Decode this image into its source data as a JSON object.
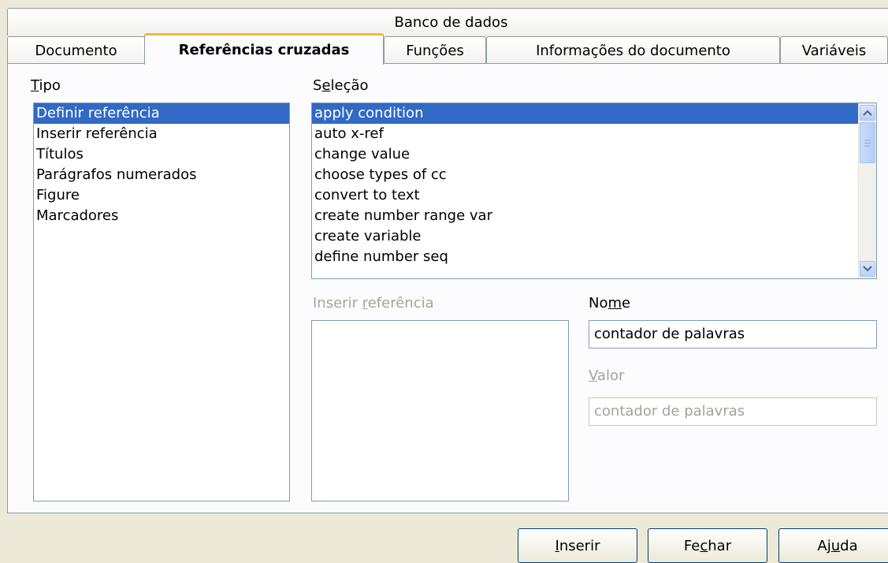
{
  "tabs": {
    "row1": "Banco de dados",
    "row2": [
      "Documento",
      "Referências cruzadas",
      "Funções",
      "Informações do documento",
      "Variáveis"
    ]
  },
  "tipo": {
    "label_u": "T",
    "label_rest": "ipo",
    "items": [
      "Definir referência",
      "Inserir referência",
      "Títulos",
      "Parágrafos numerados",
      "Figure",
      "Marcadores"
    ],
    "selected": 0
  },
  "selecao": {
    "label_pre": "S",
    "label_u": "e",
    "label_rest": "leção",
    "items": [
      "apply condition",
      "auto x-ref",
      "change value",
      "choose types of cc",
      "convert to text",
      "create number range var",
      "create variable",
      "define number seq"
    ],
    "selected": 0
  },
  "inserir_ref": {
    "label_pre": "Inserir ",
    "label_u": "r",
    "label_rest": "eferência"
  },
  "nome": {
    "label_pre": "No",
    "label_u": "m",
    "label_rest": "e",
    "value": "contador de palavras"
  },
  "valor": {
    "label_u": "V",
    "label_rest": "alor",
    "value": "contador de palavras"
  },
  "buttons": {
    "inserir_u": "I",
    "inserir_rest": "nserir",
    "fechar_pre": "Fe",
    "fechar_u": "c",
    "fechar_rest": "har",
    "ajuda_pre": "Aj",
    "ajuda_u": "u",
    "ajuda_rest": "da"
  },
  "icons": {
    "scroll_up": "scroll-up-arrow",
    "scroll_down": "scroll-down-arrow"
  },
  "colors": {
    "selection": "#316ac5",
    "active_tab_accent": "#f5b83b"
  }
}
